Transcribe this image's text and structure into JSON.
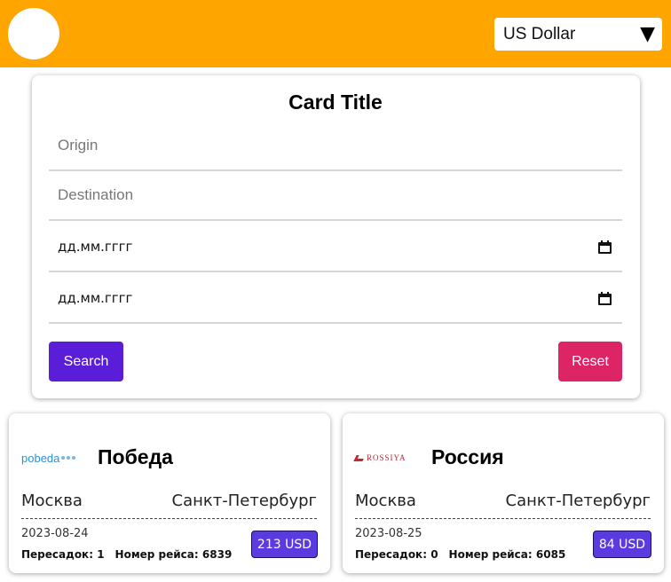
{
  "header": {
    "currency_selected": "US Dollar",
    "background_color": "#ffa500"
  },
  "search_form": {
    "title": "Card Title",
    "origin_placeholder": "Origin",
    "destination_placeholder": "Destination",
    "depart_date_placeholder": "дд.мм.гггг",
    "return_date_placeholder": "дд.мм.гггг",
    "search_label": "Search",
    "reset_label": "Reset",
    "search_color": "#5a1ed8",
    "reset_color": "#dd2465"
  },
  "results": [
    {
      "logo_text": "pobeda",
      "airline": "Победа",
      "origin": "Москва",
      "destination": "Санкт-Петербург",
      "date": "2023-08-24",
      "transfers_label": "Пересадок:",
      "transfers": "1",
      "flight_label": "Номер рейса:",
      "flight_number": "6839",
      "price": "213 USD"
    },
    {
      "logo_text": "ROSSIYA",
      "airline": "Россия",
      "origin": "Москва",
      "destination": "Санкт-Петербург",
      "date": "2023-08-25",
      "transfers_label": "Пересадок:",
      "transfers": "0",
      "flight_label": "Номер рейса:",
      "flight_number": "6085",
      "price": "84 USD"
    }
  ]
}
